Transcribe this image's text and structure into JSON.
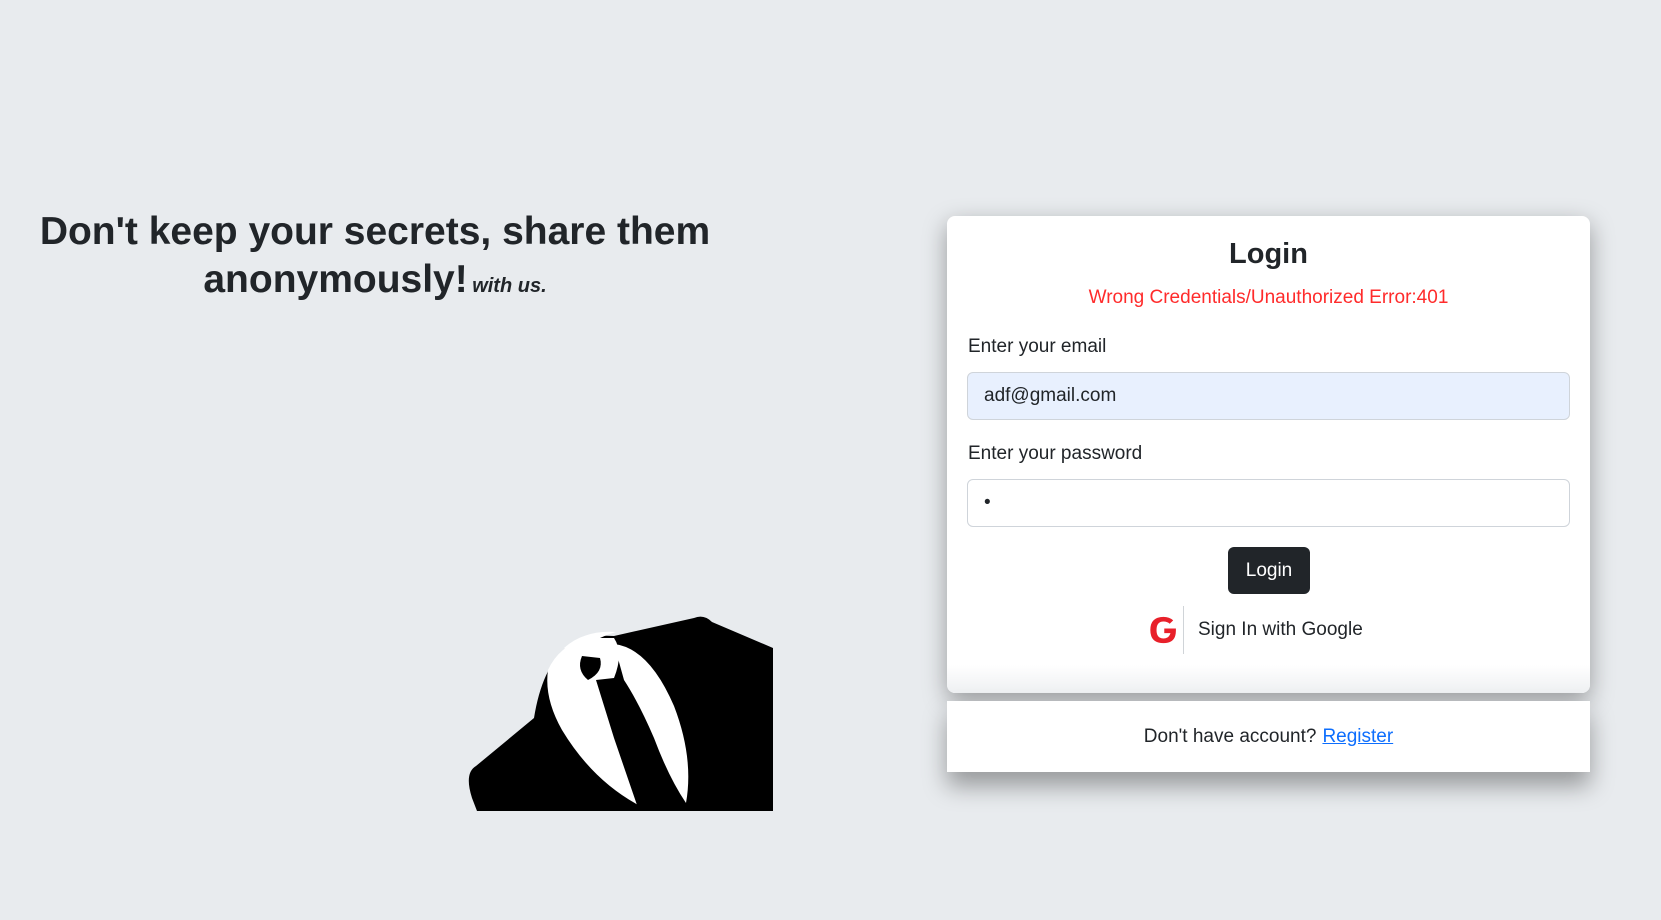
{
  "hero": {
    "title": "Don't keep your secrets, share them anonymously!",
    "subtitle": "with us."
  },
  "login": {
    "title": "Login",
    "error": "Wrong Credentials/Unauthorized Error:401",
    "email_label": "Enter your email",
    "email_value": "adf@gmail.com",
    "password_label": "Enter your password",
    "password_value": "•",
    "submit_label": "Login",
    "google_label": "Sign In with Google"
  },
  "register": {
    "prompt": "Don't have account?",
    "link_label": "Register"
  },
  "colors": {
    "background": "#e8ebee",
    "error": "#ff2b2b",
    "button": "#212529",
    "link": "#0d6efd",
    "google_icon": "#e8202a",
    "email_autofill": "#e8f0fe"
  }
}
